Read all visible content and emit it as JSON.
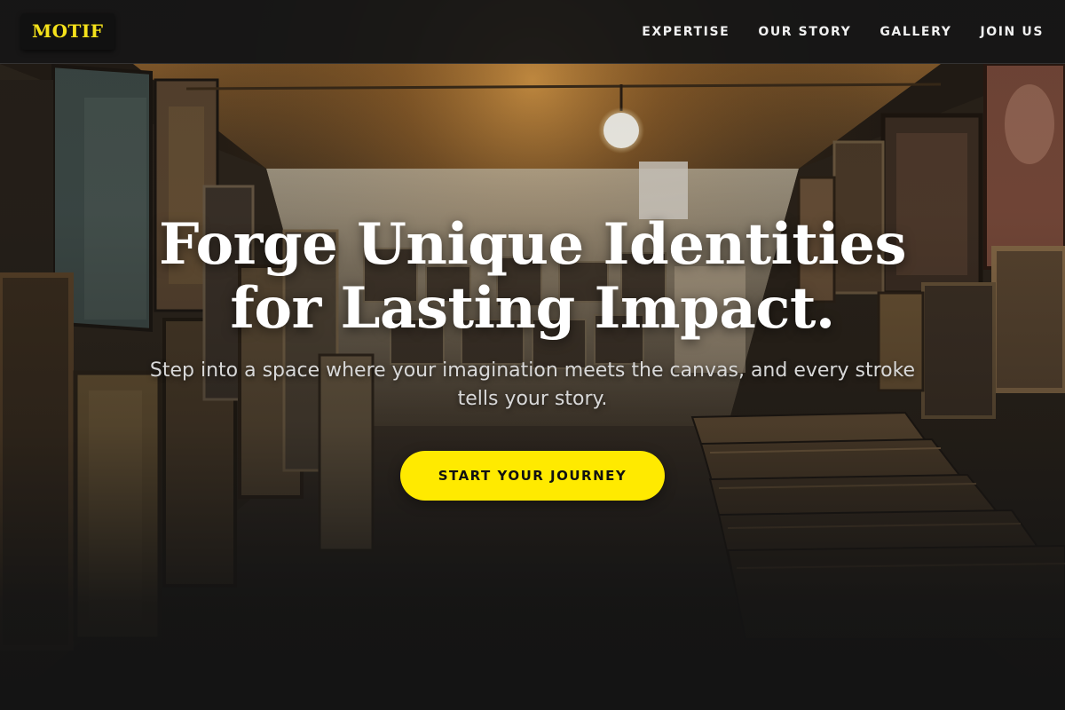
{
  "brand": {
    "logo_text": "MOTIF",
    "accent_color": "#ffea00"
  },
  "nav": {
    "items": [
      {
        "label": "EXPERTISE"
      },
      {
        "label": "OUR STORY"
      },
      {
        "label": "GALLERY"
      },
      {
        "label": "JOIN US"
      }
    ]
  },
  "hero": {
    "title_line1": "Forge Unique Identities",
    "title_line2": "for Lasting Impact.",
    "subtitle": "Step into a space where your imagination meets the canvas, and every stroke tells your story.",
    "cta_label": "START YOUR JOURNEY"
  }
}
